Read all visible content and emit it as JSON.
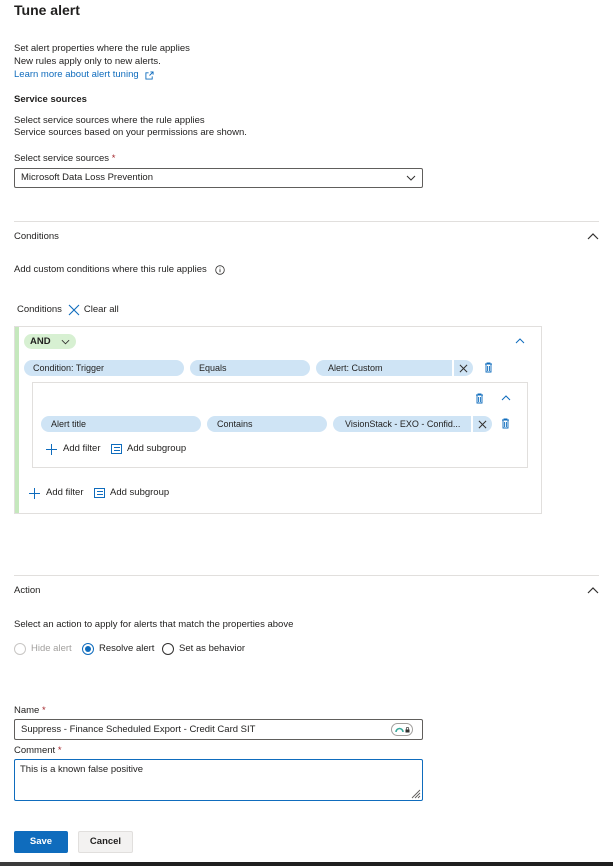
{
  "title": "Tune alert",
  "intro": {
    "line1": "Set alert properties where the rule applies",
    "line2": "New rules apply only to new alerts.",
    "learn_more": "Learn more about alert tuning"
  },
  "service_sources": {
    "heading": "Service sources",
    "desc1": "Select service sources where the rule applies",
    "desc2": "Service sources based on your permissions are shown.",
    "select_label": "Select service sources",
    "required_mark": "*",
    "selected_value": "Microsoft Data Loss Prevention"
  },
  "conditions_section": {
    "heading": "Conditions",
    "desc": "Add custom conditions where this rule applies",
    "conditions_label": "Conditions",
    "clear_all": "Clear all",
    "operator": "AND",
    "row1": {
      "field": "Condition: Trigger",
      "op": "Equals",
      "value": "Alert: Custom"
    },
    "subgroup": {
      "row1": {
        "field": "Alert title",
        "op": "Contains",
        "value": "VisionStack - EXO - Confid..."
      },
      "add_filter": "Add filter",
      "add_subgroup": "Add subgroup"
    },
    "add_filter": "Add filter",
    "add_subgroup": "Add subgroup"
  },
  "action_section": {
    "heading": "Action",
    "desc": "Select an action to apply for alerts that match the properties above",
    "options": [
      "Hide alert",
      "Resolve alert",
      "Set as behavior"
    ],
    "selected": "Resolve alert"
  },
  "name_field": {
    "label": "Name",
    "required_mark": "*",
    "value": "Suppress - Finance Scheduled Export - Credit Card SIT"
  },
  "comment_field": {
    "label": "Comment",
    "required_mark": "*",
    "value": "This is a known false positive"
  },
  "buttons": {
    "save": "Save",
    "cancel": "Cancel"
  },
  "colors": {
    "accent": "#0f6cbd",
    "pill": "#cfe4f5",
    "and_badge": "#d7f0d2",
    "and_bar": "#c5e8bd"
  }
}
